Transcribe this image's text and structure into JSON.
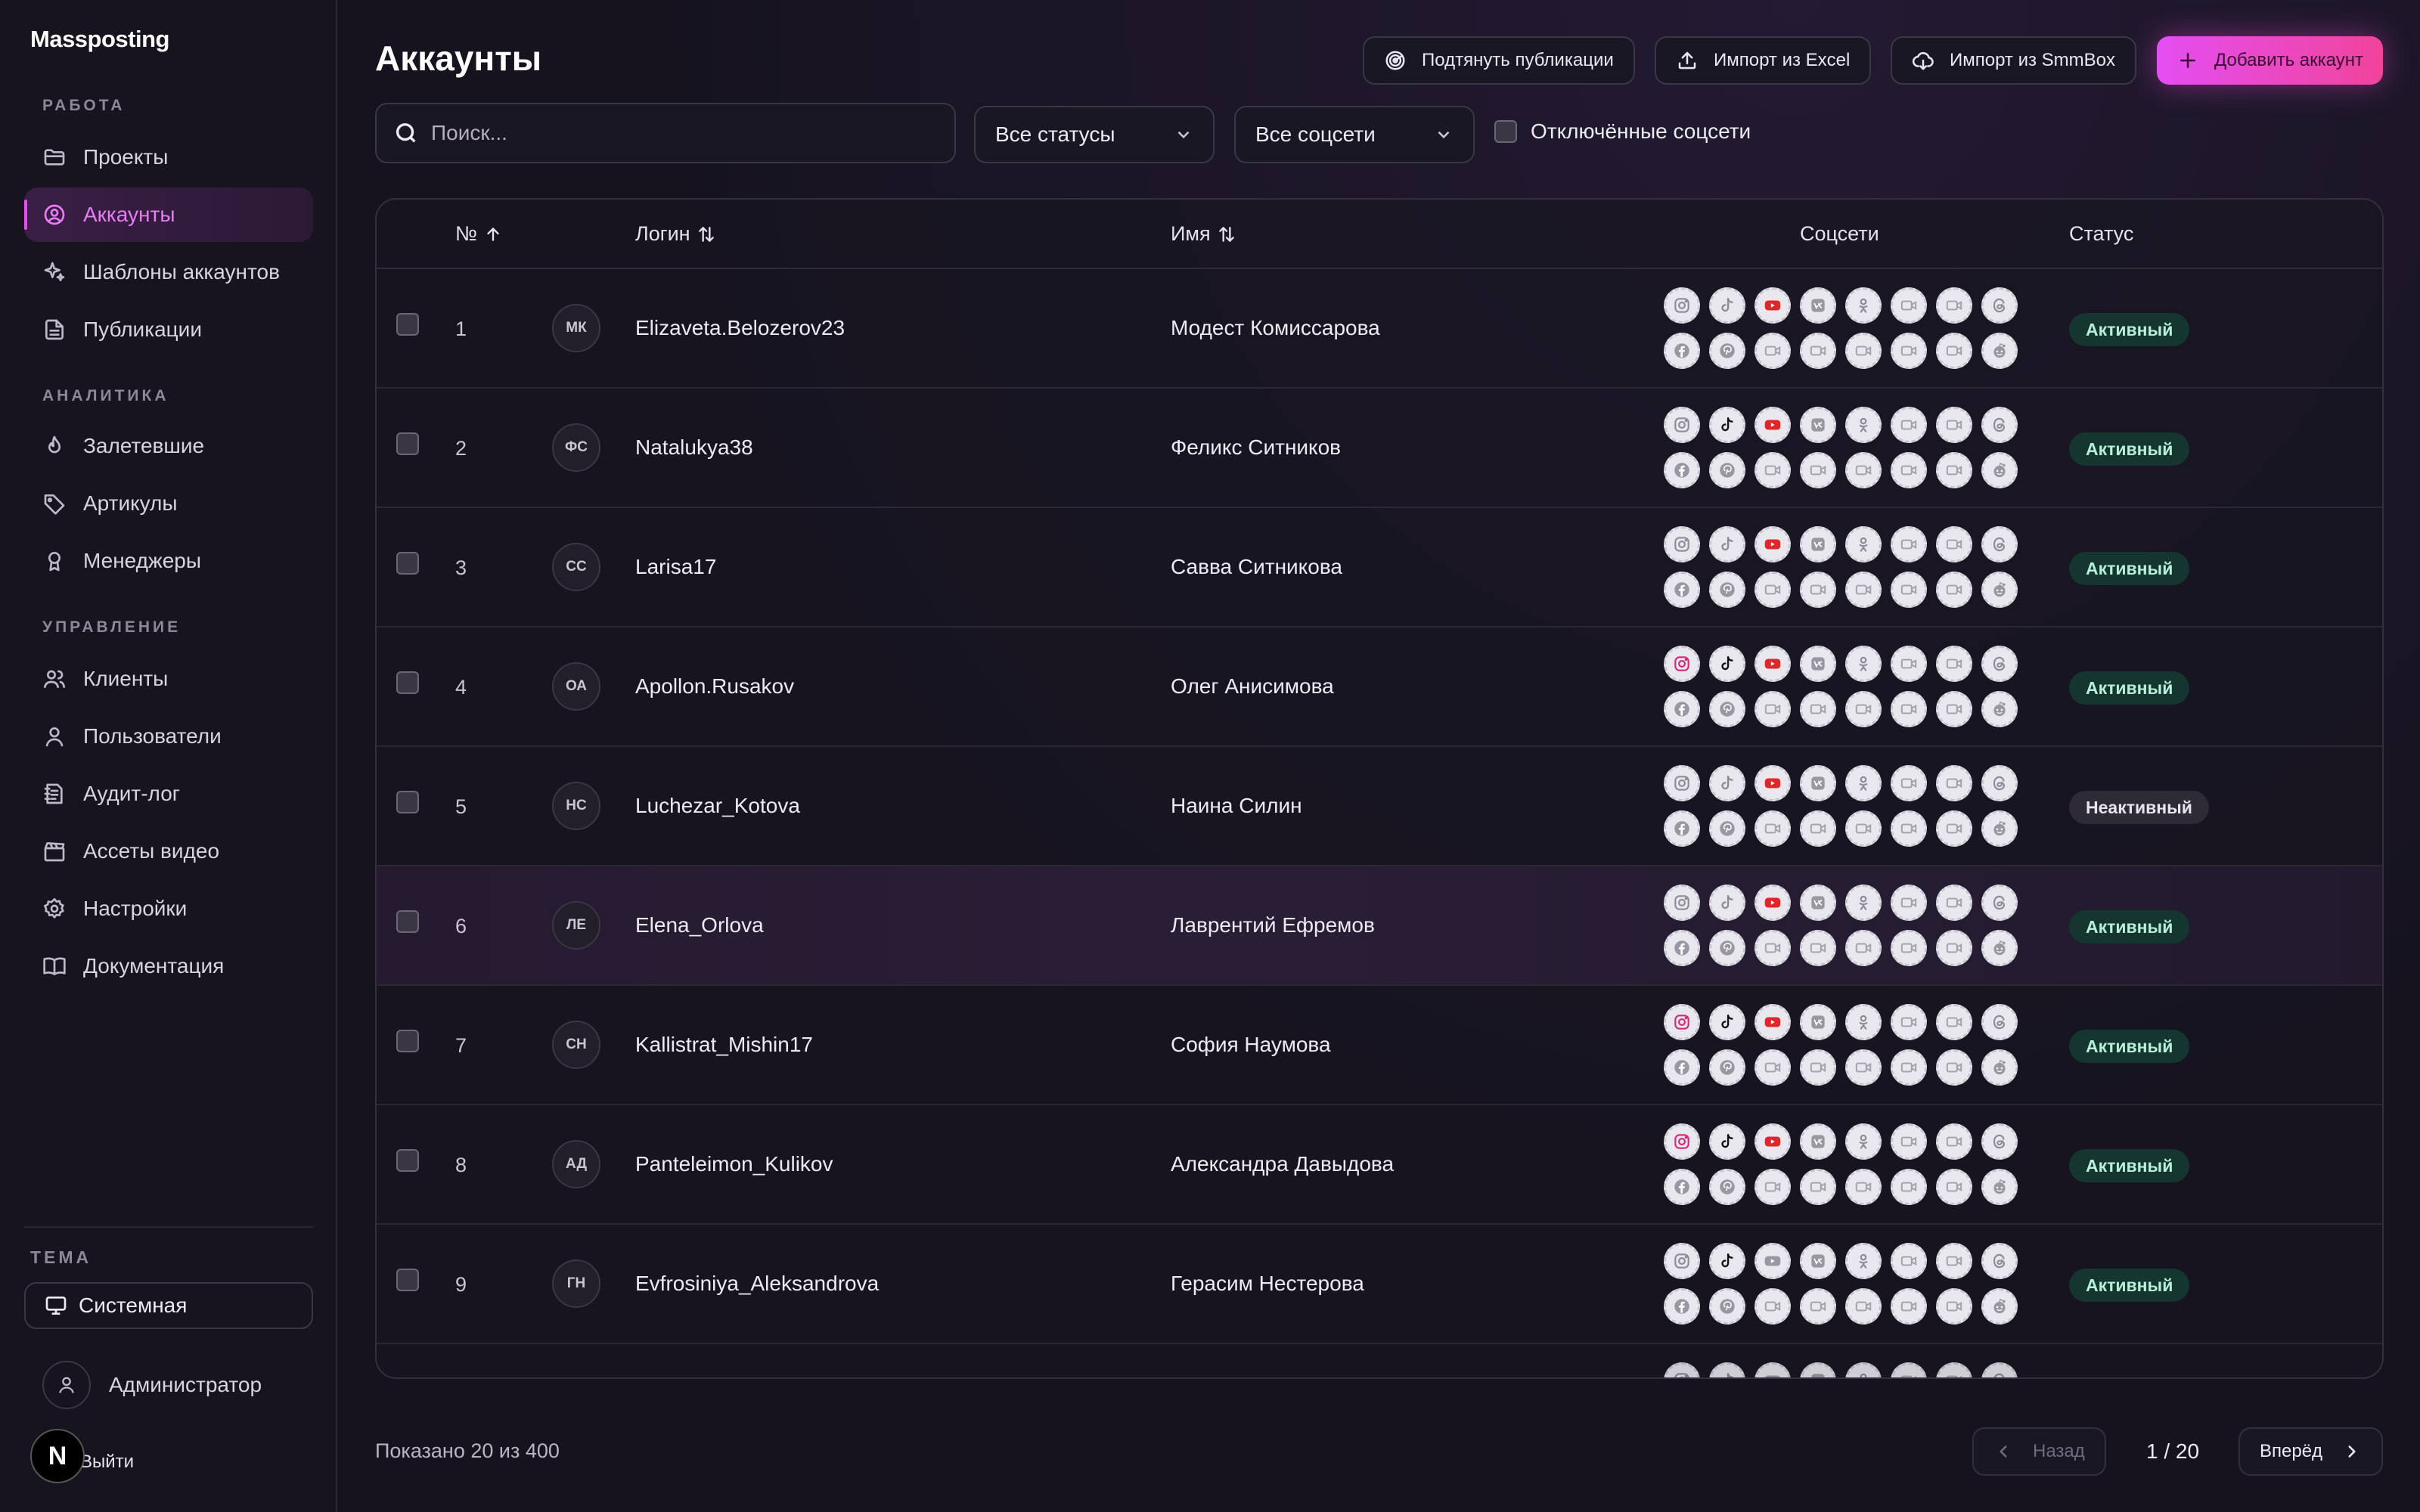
{
  "app": {
    "brand": "Massposting"
  },
  "sidebar": {
    "sections": [
      {
        "label": "РАБОТА"
      },
      {
        "label": "АНАЛИТИКА"
      },
      {
        "label": "УПРАВЛЕНИЕ"
      }
    ],
    "items": [
      {
        "label": "Проекты",
        "icon": "folder-icon"
      },
      {
        "label": "Аккаунты",
        "icon": "user-circle-icon",
        "active": true
      },
      {
        "label": "Шаблоны аккаунтов",
        "icon": "sparkles-icon"
      },
      {
        "label": "Публикации",
        "icon": "file-icon"
      },
      {
        "label": "Залетевшие",
        "icon": "flame-icon"
      },
      {
        "label": "Артикулы",
        "icon": "tag-icon"
      },
      {
        "label": "Менеджеры",
        "icon": "award-icon"
      },
      {
        "label": "Клиенты",
        "icon": "users-icon"
      },
      {
        "label": "Пользователи",
        "icon": "user-icon"
      },
      {
        "label": "Аудит-лог",
        "icon": "log-icon"
      },
      {
        "label": "Ассеты видео",
        "icon": "clapper-icon"
      },
      {
        "label": "Настройки",
        "icon": "gear-icon"
      },
      {
        "label": "Документация",
        "icon": "book-icon"
      }
    ],
    "theme": {
      "label": "ТЕМА",
      "value": "Системная"
    },
    "user": {
      "name": "Администратор",
      "logout": "Выйти",
      "badge": "N"
    }
  },
  "header": {
    "title": "Аккаунты",
    "buttons": {
      "pull": "Подтянуть публикации",
      "import_excel": "Импорт из Excel",
      "import_smmbox": "Импорт из SmmBox",
      "add": "Добавить аккаунт"
    }
  },
  "filters": {
    "search_placeholder": "Поиск...",
    "status": "Все статусы",
    "networks": "Все соцсети",
    "disabled_networks": "Отключённые соцсети"
  },
  "table": {
    "columns": {
      "num": "№",
      "login": "Логин",
      "name": "Имя",
      "socials": "Соцсети",
      "status": "Статус"
    },
    "rows": [
      {
        "num": "1",
        "initials": "МК",
        "login": "Elizaveta.Belozerov23",
        "name": "Модест Комиссарова",
        "status": "Активный",
        "ig": false,
        "tt": false,
        "yt": true
      },
      {
        "num": "2",
        "initials": "ФС",
        "login": "Natalukya38",
        "name": "Феликс Ситников",
        "status": "Активный",
        "ig": false,
        "tt": true,
        "yt": true
      },
      {
        "num": "3",
        "initials": "СС",
        "login": "Larisa17",
        "name": "Савва Ситникова",
        "status": "Активный",
        "ig": false,
        "tt": false,
        "yt": true
      },
      {
        "num": "4",
        "initials": "ОА",
        "login": "Apollon.Rusakov",
        "name": "Олег Анисимова",
        "status": "Активный",
        "ig": true,
        "tt": true,
        "yt": true
      },
      {
        "num": "5",
        "initials": "НС",
        "login": "Luchezar_Kotova",
        "name": "Наина Силин",
        "status": "Неактивный",
        "ig": false,
        "tt": false,
        "yt": true
      },
      {
        "num": "6",
        "initials": "ЛЕ",
        "login": "Elena_Orlova",
        "name": "Лаврентий Ефремов",
        "status": "Активный",
        "ig": false,
        "tt": false,
        "yt": true
      },
      {
        "num": "7",
        "initials": "СН",
        "login": "Kallistrat_Mishin17",
        "name": "София Наумова",
        "status": "Активный",
        "ig": true,
        "tt": true,
        "yt": true
      },
      {
        "num": "8",
        "initials": "АД",
        "login": "Panteleimon_Kulikov",
        "name": "Александра Давыдова",
        "status": "Активный",
        "ig": true,
        "tt": true,
        "yt": true
      },
      {
        "num": "9",
        "initials": "ГН",
        "login": "Evfrosiniya_Aleksandrova",
        "name": "Герасим Нестерова",
        "status": "Активный",
        "ig": false,
        "tt": true,
        "yt": false
      }
    ],
    "social_icons_row1": [
      "instagram-icon",
      "tiktok-icon",
      "youtube-icon",
      "vk-icon",
      "odnoklassniki-icon",
      "video-icon",
      "video-icon",
      "threads-icon"
    ],
    "social_icons_row2": [
      "facebook-icon",
      "pinterest-icon",
      "video-icon",
      "video-icon",
      "video-icon",
      "video-icon",
      "video-icon",
      "reddit-icon"
    ]
  },
  "footer": {
    "shown": "Показано 20 из 400",
    "prev": "Назад",
    "page": "1 / 20",
    "next": "Вперёд"
  },
  "colors": {
    "accent": "#e24ef0",
    "active_badge_bg": "#15352f",
    "youtube": "#e0262b",
    "instagram": "#d62976"
  }
}
